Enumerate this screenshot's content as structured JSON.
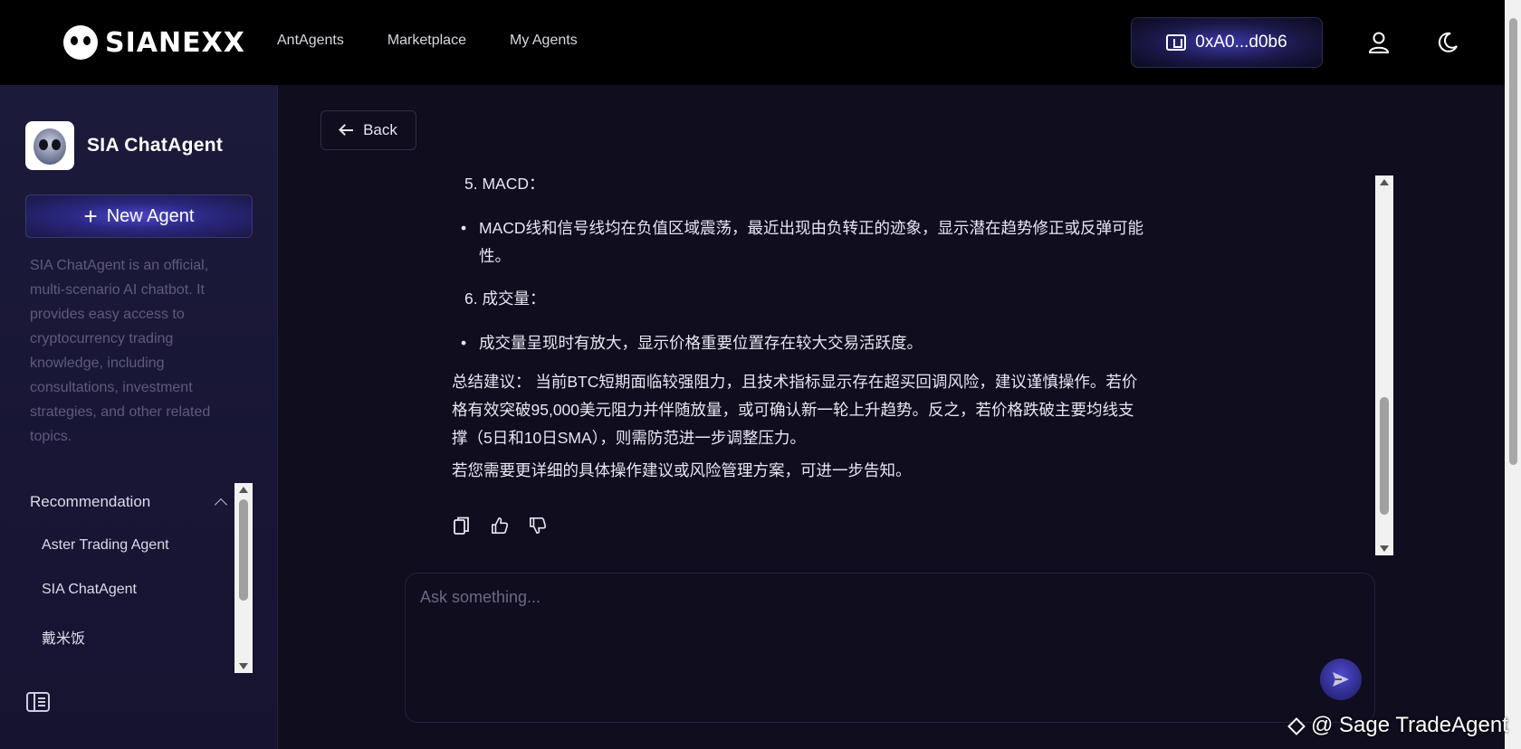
{
  "header": {
    "logo_text": "SIANEXX",
    "nav": [
      "AntAgents",
      "Marketplace",
      "My Agents"
    ],
    "wallet": "0xA0...d0b6"
  },
  "sidebar": {
    "agent_name": "SIA ChatAgent",
    "new_agent_label": "New Agent",
    "description": "SIA ChatAgent is an official, multi-scenario AI chatbot. It provides easy access to cryptocurrency trading knowledge, including consultations, investment strategies, and other related topics.",
    "recommendation_label": "Recommendation",
    "recommendations": [
      "Aster Trading Agent",
      "SIA ChatAgent",
      "戴米饭"
    ]
  },
  "main": {
    "back_label": "Back",
    "message": {
      "item5_title": "5. MACD：",
      "item5_bullet": "MACD线和信号线均在负值区域震荡，最近出现由负转正的迹象，显示潜在趋势修正或反弹可能性。",
      "item6_title": "6. 成交量：",
      "item6_bullet": "成交量呈现时有放大，显示价格重要位置存在较大交易活跃度。",
      "summary": "总结建议： 当前BTC短期面临较强阻力，且技术指标显示存在超买回调风险，建议谨慎操作。若价格有效突破95,000美元阻力并伴随放量，或可确认新一轮上升趋势。反之，若价格跌破主要均线支撑（5日和10日SMA），则需防范进一步调整压力。",
      "closing": "若您需要更详细的具体操作建议或风险管理方案，可进一步告知。"
    },
    "input_placeholder": "Ask something..."
  },
  "watermark": "@ Sage TradeAgent",
  "colors": {
    "accent": "#3b38a8",
    "background": "#0f0d1e",
    "sidebar": "#1c1a3a",
    "topbar": "#000000"
  }
}
